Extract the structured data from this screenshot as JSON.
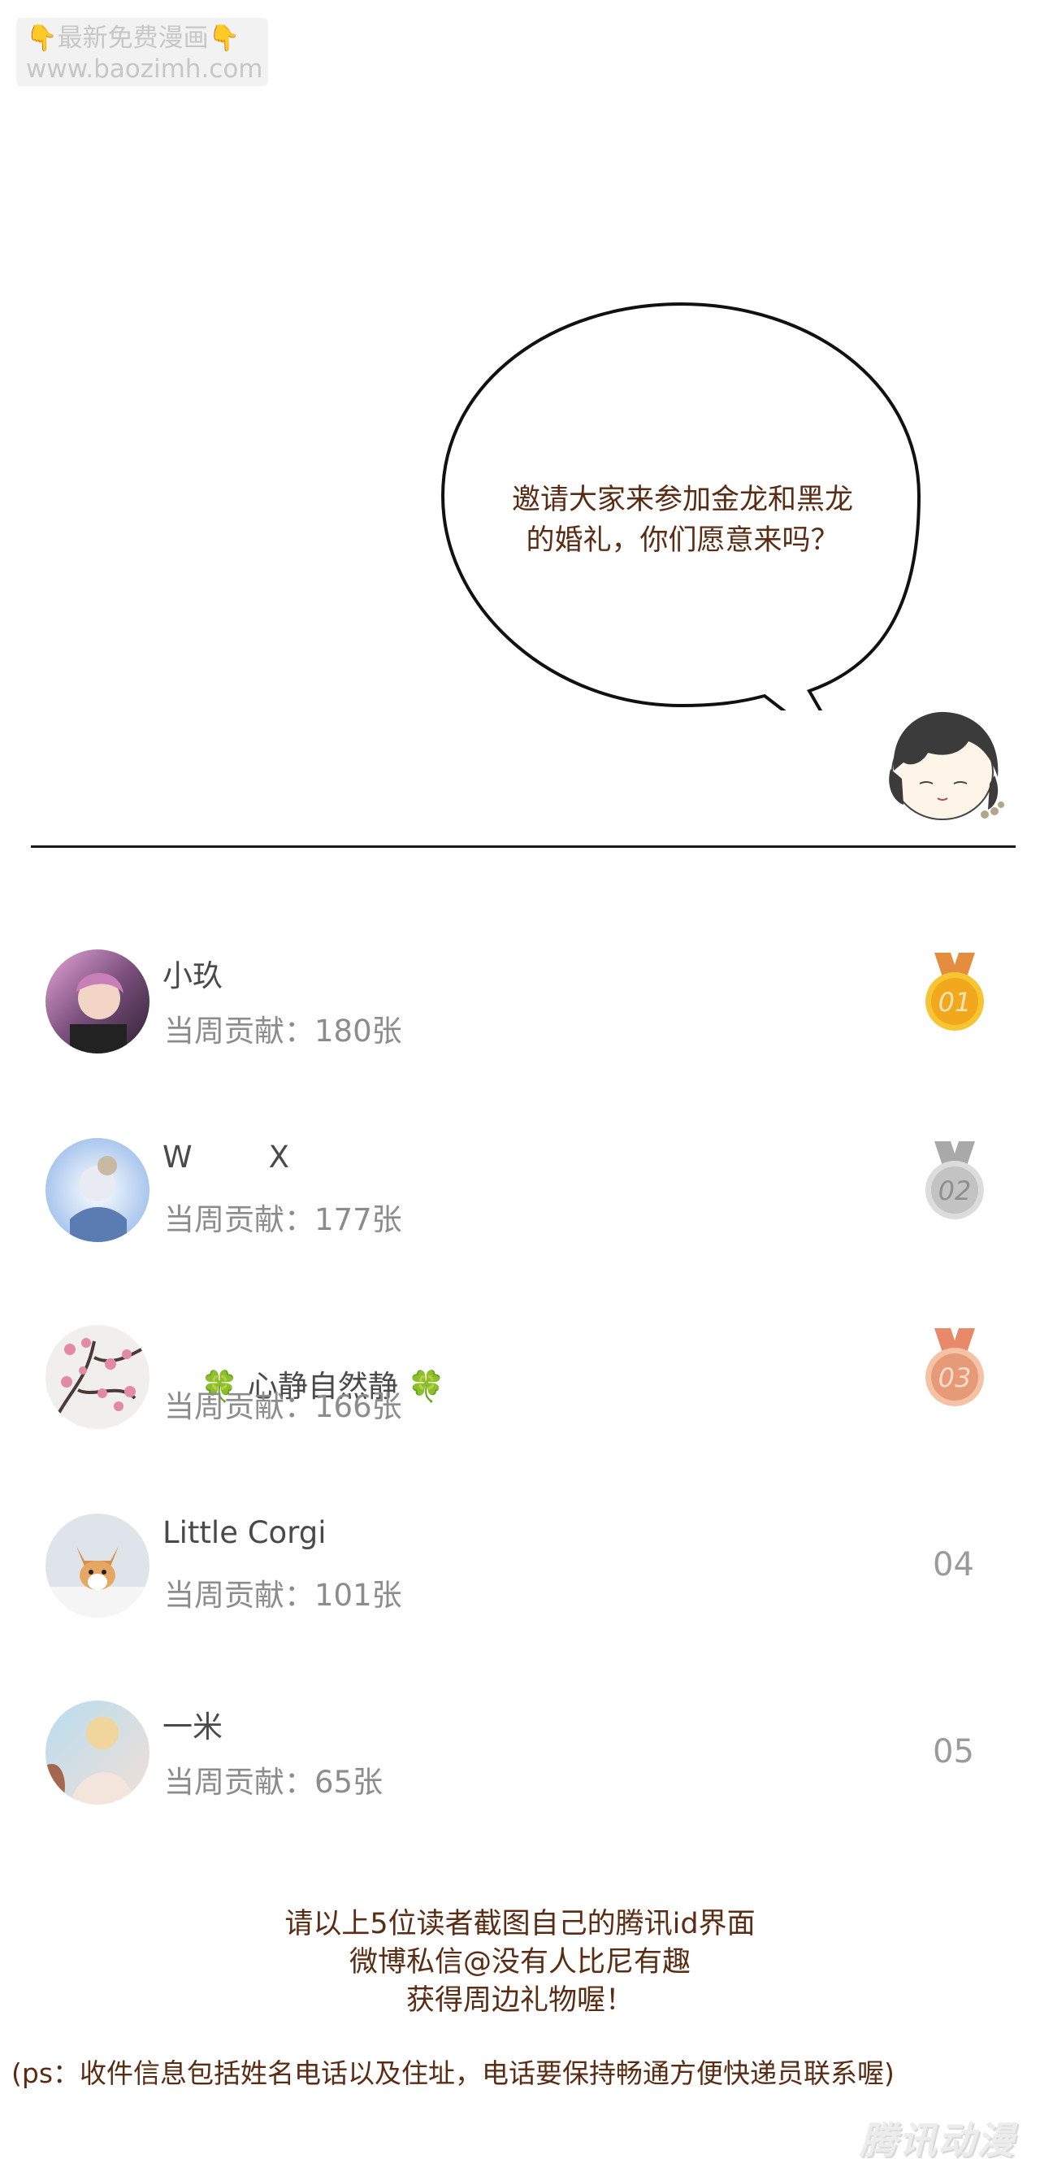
{
  "watermark": {
    "line1": "最新免费漫画",
    "line2": "www.baozimh.com",
    "hand_icon": "pointing-down-hand-icon"
  },
  "speech": {
    "line1": "邀请大家来参加金龙和黑龙",
    "line2": "的婚礼，你们愿意来吗？"
  },
  "ranking": {
    "contrib_prefix": "当周贡献：",
    "items": [
      {
        "name": "小玖",
        "contribution": "当周贡献：180张",
        "rank": "01",
        "medal": "gold"
      },
      {
        "name": "W        X",
        "contribution": "当周贡献：177张",
        "rank": "02",
        "medal": "silver"
      },
      {
        "name": "心静自然静",
        "contribution": "当周贡献：166张",
        "rank": "03",
        "medal": "bronze"
      },
      {
        "name": "Little Corgi",
        "contribution": "当周贡献：101张",
        "rank": "04",
        "medal": ""
      },
      {
        "name": "一米",
        "contribution": "当周贡献：65张",
        "rank": "05",
        "medal": ""
      }
    ]
  },
  "notice": {
    "line1": "请以上5位读者截图自己的腾讯id界面",
    "line2": "微博私信@没有人比尼有趣",
    "line3": "获得周边礼物喔！",
    "ps": "(ps：收件信息包括姓名电话以及住址，电话要保持畅通方便快递员联系喔)"
  },
  "logo": {
    "text": "腾讯动漫"
  },
  "colors": {
    "text_brown": "#5a2c14",
    "gold": "#f2a81d",
    "silver": "#b5b5b5",
    "bronze": "#e79a78"
  }
}
